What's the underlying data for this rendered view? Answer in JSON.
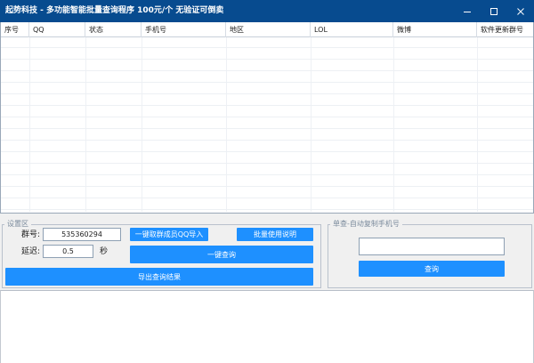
{
  "window": {
    "title": "起势科技 - 多功能智能批量查询程序   100元/个 无验证可倒卖",
    "minimize_icon": "minimize-icon",
    "maximize_icon": "maximize-icon",
    "close_icon": "close-icon"
  },
  "grid": {
    "columns": [
      "序号",
      "QQ",
      "状态",
      "手机号",
      "地区",
      "LOL",
      "微博",
      "软件更新群号"
    ],
    "rows": []
  },
  "settings": {
    "legend": "设置区",
    "group_label": "群号:",
    "group_value": "535360294",
    "delay_label": "延迟:",
    "delay_value": "0.5",
    "delay_unit": "秒",
    "btn_import_qq": "一键取群成员QQ导入",
    "btn_help": "批量使用说明",
    "btn_query_all": "一键查询",
    "btn_export": "导出查询结果"
  },
  "single": {
    "legend": "单查-自动复制手机号",
    "input_value": "",
    "btn_query": "查询"
  },
  "log": {
    "content": ""
  },
  "colors": {
    "titlebar": "#074b8f",
    "button": "#1e90ff"
  }
}
